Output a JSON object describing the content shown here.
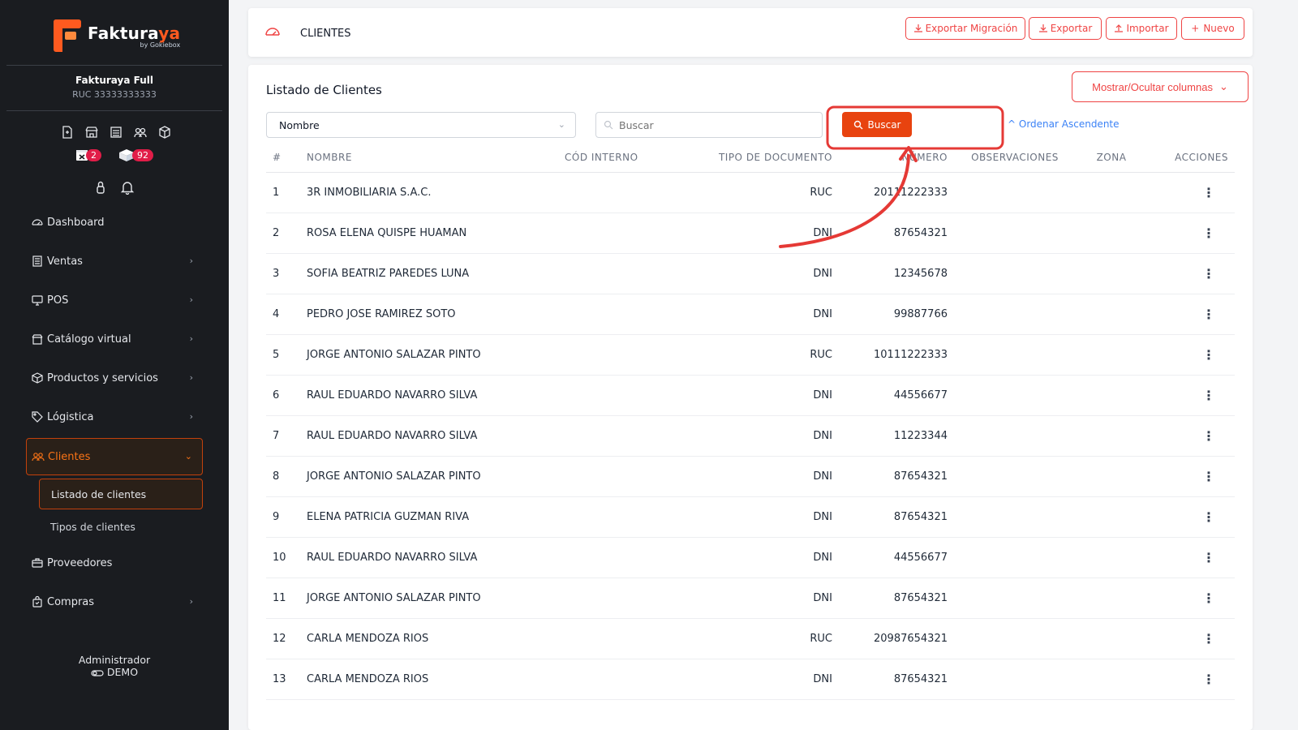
{
  "brand": {
    "name_main": "Faktura",
    "name_accent": "ya",
    "by": "by Gokiebox"
  },
  "company": {
    "name": "Fakturaya Full",
    "ruc": "RUC 33333333333"
  },
  "badges": {
    "calendar_count": "2",
    "box_count": "92"
  },
  "sidebar": {
    "items": [
      {
        "label": "Dashboard",
        "icon": "gauge-icon"
      },
      {
        "label": "Ventas",
        "icon": "receipt-icon"
      },
      {
        "label": "POS",
        "icon": "monitor-icon"
      },
      {
        "label": "Catálogo virtual",
        "icon": "store-icon"
      },
      {
        "label": "Productos y servicios",
        "icon": "box-icon"
      },
      {
        "label": "Lógistica",
        "icon": "tag-icon"
      },
      {
        "label": "Clientes",
        "icon": "users-icon"
      },
      {
        "label": "Proveedores",
        "icon": "briefcase-icon"
      },
      {
        "label": "Compras",
        "icon": "bag-icon"
      }
    ],
    "sub_items": [
      {
        "label": "Listado de clientes"
      },
      {
        "label": "Tipos de clientes"
      }
    ]
  },
  "user": {
    "role": "Administrador",
    "mode": "DEMO"
  },
  "topbar": {
    "title": "CLIENTES",
    "buttons": {
      "export_migration": "Exportar Migración",
      "export": "Exportar",
      "import": "Importar",
      "new": "Nuevo"
    }
  },
  "main": {
    "title": "Listado de Clientes",
    "columns_button": "Mostrar/Ocultar columnas",
    "filter_select": "Nombre",
    "search_placeholder": "Buscar",
    "search_button": "Buscar",
    "order_link": "Ordenar Ascendente",
    "table": {
      "headers": [
        "#",
        "NOMBRE",
        "CÓD INTERNO",
        "TIPO DE DOCUMENTO",
        "NÚMERO",
        "OBSERVACIONES",
        "ZONA",
        "ACCIONES"
      ],
      "rows": [
        {
          "n": "1",
          "nombre": "3R INMOBILIARIA S.A.C.",
          "cod": "",
          "tipo": "RUC",
          "numero": "20111222333"
        },
        {
          "n": "2",
          "nombre": "ROSA ELENA QUISPE HUAMAN",
          "cod": "",
          "tipo": "DNI",
          "numero": "87654321"
        },
        {
          "n": "3",
          "nombre": "SOFIA BEATRIZ PAREDES LUNA",
          "cod": "",
          "tipo": "DNI",
          "numero": "12345678"
        },
        {
          "n": "4",
          "nombre": "PEDRO JOSE RAMIREZ SOTO",
          "cod": "",
          "tipo": "DNI",
          "numero": "99887766"
        },
        {
          "n": "5",
          "nombre": "JORGE ANTONIO SALAZAR PINTO",
          "cod": "",
          "tipo": "RUC",
          "numero": "10111222333"
        },
        {
          "n": "6",
          "nombre": "RAUL EDUARDO NAVARRO SILVA",
          "cod": "",
          "tipo": "DNI",
          "numero": "44556677"
        },
        {
          "n": "7",
          "nombre": "RAUL EDUARDO NAVARRO SILVA",
          "cod": "",
          "tipo": "DNI",
          "numero": "11223344"
        },
        {
          "n": "8",
          "nombre": "JORGE ANTONIO SALAZAR PINTO",
          "cod": "",
          "tipo": "DNI",
          "numero": "87654321"
        },
        {
          "n": "9",
          "nombre": "ELENA PATRICIA GUZMAN RIVA",
          "cod": "",
          "tipo": "DNI",
          "numero": "87654321"
        },
        {
          "n": "10",
          "nombre": "RAUL EDUARDO NAVARRO SILVA",
          "cod": "",
          "tipo": "DNI",
          "numero": "44556677"
        },
        {
          "n": "11",
          "nombre": "JORGE ANTONIO SALAZAR PINTO",
          "cod": "",
          "tipo": "DNI",
          "numero": "87654321"
        },
        {
          "n": "12",
          "nombre": "CARLA MENDOZA RIOS",
          "cod": "",
          "tipo": "RUC",
          "numero": "20987654321"
        },
        {
          "n": "13",
          "nombre": "CARLA MENDOZA RIOS",
          "cod": "",
          "tipo": "DNI",
          "numero": "87654321"
        }
      ]
    }
  },
  "colors": {
    "accent": "#e8430f",
    "sidebar_bg": "#1a1c20",
    "annotation": "#e53935",
    "link": "#3b82f6"
  }
}
